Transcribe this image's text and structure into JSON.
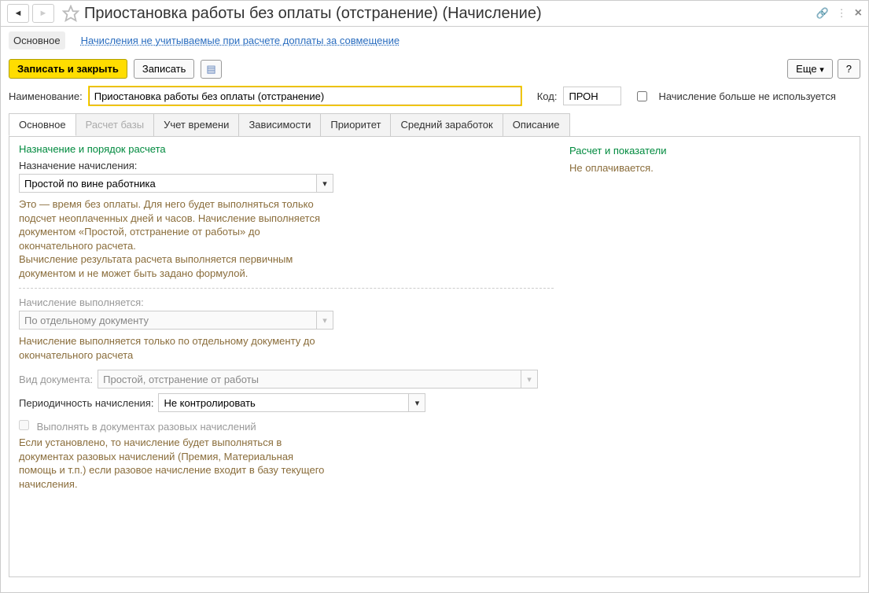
{
  "header": {
    "title": "Приостановка работы без оплаты (отстранение) (Начисление)"
  },
  "topnav": {
    "active": "Основное",
    "link": "Начисления не учитываемые при расчете доплаты за совмещение"
  },
  "toolbar": {
    "save_close": "Записать и закрыть",
    "save": "Записать",
    "more": "Еще",
    "help": "?"
  },
  "form": {
    "name_label": "Наименование:",
    "name_value": "Приостановка работы без оплаты (отстранение)",
    "code_label": "Код:",
    "code_value": "ПРОН",
    "not_used_label": "Начисление больше не используется"
  },
  "tabs": [
    "Основное",
    "Расчет базы",
    "Учет времени",
    "Зависимости",
    "Приоритет",
    "Средний заработок",
    "Описание"
  ],
  "left": {
    "section1": "Назначение и порядок расчета",
    "assign_label": "Назначение начисления:",
    "assign_value": "Простой по вине работника",
    "assign_desc": "Это — время без оплаты. Для него будет выполняться только подсчет неоплаченных дней и часов. Начисление выполняется документом «Простой, отстранение от работы» до окончательного расчета.\nВычисление результата расчета выполняется первичным документом и не может быть задано формулой.",
    "exec_label": "Начисление выполняется:",
    "exec_value": "По отдельному документу",
    "exec_desc": "Начисление выполняется только по отдельному документу до окончательного расчета",
    "doc_label": "Вид документа:",
    "doc_value": "Простой, отстранение от работы",
    "period_label": "Периодичность начисления:",
    "period_value": "Не контролировать",
    "chk_once_label": "Выполнять в документах разовых начислений",
    "once_desc": "Если установлено, то начисление будет выполняться в документах разовых начислений (Премия, Материальная помощь и т.п.) если разовое начисление входит в базу текущего начисления."
  },
  "right": {
    "section": "Расчет и показатели",
    "text": "Не оплачивается."
  }
}
